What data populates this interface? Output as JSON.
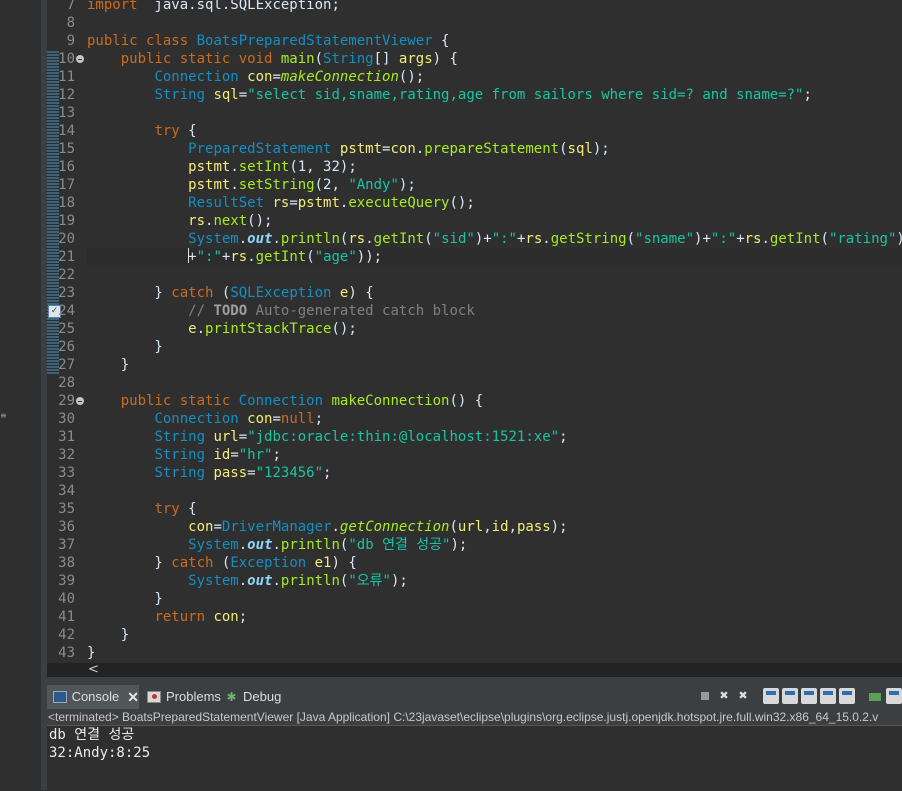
{
  "editor": {
    "lines": [
      {
        "n": "7",
        "t": [
          [
            "kw",
            "import"
          ],
          [
            "",
            "  java.sql.SQLException;"
          ]
        ]
      },
      {
        "n": "8",
        "t": []
      },
      {
        "n": "9",
        "t": [
          [
            "kw",
            "public class"
          ],
          [
            "",
            " "
          ],
          [
            "ty",
            "BoatsPreparedStatementViewer"
          ],
          [
            "",
            " {"
          ]
        ]
      },
      {
        "n": "10",
        "fold": true,
        "qd": true,
        "t": [
          [
            "",
            "    "
          ],
          [
            "kw",
            "public static void"
          ],
          [
            "",
            " "
          ],
          [
            "mt",
            "main"
          ],
          [
            "",
            "("
          ],
          [
            "ty",
            "String"
          ],
          [
            "",
            "[] "
          ],
          [
            "va",
            "args"
          ],
          [
            "",
            ") {"
          ]
        ]
      },
      {
        "n": "11",
        "qd": true,
        "t": [
          [
            "",
            "        "
          ],
          [
            "ty",
            "Connection"
          ],
          [
            "",
            " "
          ],
          [
            "va",
            "con"
          ],
          [
            "",
            "="
          ],
          [
            "sm",
            "makeConnection"
          ],
          [
            "",
            "();"
          ]
        ]
      },
      {
        "n": "12",
        "qd": true,
        "t": [
          [
            "",
            "        "
          ],
          [
            "ty",
            "String"
          ],
          [
            "",
            " "
          ],
          [
            "va",
            "sql"
          ],
          [
            "",
            "="
          ],
          [
            "st",
            "\"select sid,sname,rating,age from sailors where sid=? and sname=?\""
          ],
          [
            "",
            ";"
          ]
        ]
      },
      {
        "n": "13",
        "qd": true,
        "t": []
      },
      {
        "n": "14",
        "qd": true,
        "t": [
          [
            "",
            "        "
          ],
          [
            "kw",
            "try"
          ],
          [
            "",
            " {"
          ]
        ]
      },
      {
        "n": "15",
        "qd": true,
        "t": [
          [
            "",
            "            "
          ],
          [
            "ty",
            "PreparedStatement"
          ],
          [
            "",
            " "
          ],
          [
            "va",
            "pstmt"
          ],
          [
            "",
            "="
          ],
          [
            "va",
            "con"
          ],
          [
            "",
            "."
          ],
          [
            "mt",
            "prepareStatement"
          ],
          [
            "",
            "("
          ],
          [
            "va",
            "sql"
          ],
          [
            "",
            ");"
          ]
        ]
      },
      {
        "n": "16",
        "qd": true,
        "t": [
          [
            "",
            "            "
          ],
          [
            "va",
            "pstmt"
          ],
          [
            "",
            "."
          ],
          [
            "mt",
            "setInt"
          ],
          [
            "",
            "(1, 32);"
          ]
        ]
      },
      {
        "n": "17",
        "qd": true,
        "t": [
          [
            "",
            "            "
          ],
          [
            "va",
            "pstmt"
          ],
          [
            "",
            "."
          ],
          [
            "mt",
            "setString"
          ],
          [
            "",
            "(2, "
          ],
          [
            "st",
            "\"Andy\""
          ],
          [
            "",
            ");"
          ]
        ]
      },
      {
        "n": "18",
        "qd": true,
        "t": [
          [
            "",
            "            "
          ],
          [
            "ty",
            "ResultSet"
          ],
          [
            "",
            " "
          ],
          [
            "va",
            "rs"
          ],
          [
            "",
            "="
          ],
          [
            "va",
            "pstmt"
          ],
          [
            "",
            "."
          ],
          [
            "mt",
            "executeQuery"
          ],
          [
            "",
            "();"
          ]
        ]
      },
      {
        "n": "19",
        "qd": true,
        "t": [
          [
            "",
            "            "
          ],
          [
            "va",
            "rs"
          ],
          [
            "",
            "."
          ],
          [
            "mt",
            "next"
          ],
          [
            "",
            "();"
          ]
        ]
      },
      {
        "n": "20",
        "qd": true,
        "t": [
          [
            "",
            "            "
          ],
          [
            "ty",
            "System"
          ],
          [
            "",
            "."
          ],
          [
            "fi",
            "out"
          ],
          [
            "",
            "."
          ],
          [
            "mt",
            "println"
          ],
          [
            "",
            "("
          ],
          [
            "va",
            "rs"
          ],
          [
            "",
            "."
          ],
          [
            "mt",
            "getInt"
          ],
          [
            "",
            "("
          ],
          [
            "st",
            "\"sid\""
          ],
          [
            "",
            ")+"
          ],
          [
            "st",
            "\":\""
          ],
          [
            "",
            "+"
          ],
          [
            "va",
            "rs"
          ],
          [
            "",
            "."
          ],
          [
            "mt",
            "getString"
          ],
          [
            "",
            "("
          ],
          [
            "st",
            "\"sname\""
          ],
          [
            "",
            ")+"
          ],
          [
            "st",
            "\":\""
          ],
          [
            "",
            "+"
          ],
          [
            "va",
            "rs"
          ],
          [
            "",
            "."
          ],
          [
            "mt",
            "getInt"
          ],
          [
            "",
            "("
          ],
          [
            "st",
            "\"rating\""
          ],
          [
            "",
            ")"
          ]
        ]
      },
      {
        "n": "21",
        "qd": true,
        "current": true,
        "t": [
          [
            "",
            "            "
          ],
          [
            "caret",
            ""
          ],
          [
            "",
            "+"
          ],
          [
            "st",
            "\":\""
          ],
          [
            "",
            "+"
          ],
          [
            "va",
            "rs"
          ],
          [
            "",
            "."
          ],
          [
            "mt",
            "getInt"
          ],
          [
            "",
            "("
          ],
          [
            "st",
            "\"age\""
          ],
          [
            "",
            "));"
          ]
        ]
      },
      {
        "n": "22",
        "qd": true,
        "t": []
      },
      {
        "n": "23",
        "qd": true,
        "t": [
          [
            "",
            "        } "
          ],
          [
            "kw",
            "catch"
          ],
          [
            "",
            " ("
          ],
          [
            "ty",
            "SQLException"
          ],
          [
            "",
            " "
          ],
          [
            "va",
            "e"
          ],
          [
            "",
            ") {"
          ]
        ]
      },
      {
        "n": "24",
        "qd": true,
        "task": true,
        "t": [
          [
            "",
            "            "
          ],
          [
            "cm",
            "// "
          ],
          [
            "td",
            "TODO"
          ],
          [
            "cm",
            " Auto-generated catch block"
          ]
        ]
      },
      {
        "n": "25",
        "qd": true,
        "t": [
          [
            "",
            "            "
          ],
          [
            "va",
            "e"
          ],
          [
            "",
            "."
          ],
          [
            "mt",
            "printStackTrace"
          ],
          [
            "",
            "();"
          ]
        ]
      },
      {
        "n": "26",
        "qd": true,
        "t": [
          [
            "",
            "        }"
          ]
        ]
      },
      {
        "n": "27",
        "qd": true,
        "t": [
          [
            "",
            "    }"
          ]
        ]
      },
      {
        "n": "28",
        "t": []
      },
      {
        "n": "29",
        "fold": true,
        "t": [
          [
            "",
            "    "
          ],
          [
            "kw",
            "public static"
          ],
          [
            "",
            " "
          ],
          [
            "ty",
            "Connection"
          ],
          [
            "",
            " "
          ],
          [
            "mt",
            "makeConnection"
          ],
          [
            "",
            "() {"
          ]
        ]
      },
      {
        "n": "30",
        "t": [
          [
            "",
            "        "
          ],
          [
            "ty",
            "Connection"
          ],
          [
            "",
            " "
          ],
          [
            "va",
            "con"
          ],
          [
            "",
            "="
          ],
          [
            "kw",
            "null"
          ],
          [
            "",
            ";"
          ]
        ]
      },
      {
        "n": "31",
        "t": [
          [
            "",
            "        "
          ],
          [
            "ty",
            "String"
          ],
          [
            "",
            " "
          ],
          [
            "va",
            "url"
          ],
          [
            "",
            "="
          ],
          [
            "st",
            "\"jdbc:oracle:thin:@localhost:1521:xe\""
          ],
          [
            "",
            ";"
          ]
        ]
      },
      {
        "n": "32",
        "t": [
          [
            "",
            "        "
          ],
          [
            "ty",
            "String"
          ],
          [
            "",
            " "
          ],
          [
            "va",
            "id"
          ],
          [
            "",
            "="
          ],
          [
            "st",
            "\"hr\""
          ],
          [
            "",
            ";"
          ]
        ]
      },
      {
        "n": "33",
        "t": [
          [
            "",
            "        "
          ],
          [
            "ty",
            "String"
          ],
          [
            "",
            " "
          ],
          [
            "va",
            "pass"
          ],
          [
            "",
            "="
          ],
          [
            "st",
            "\"123456\""
          ],
          [
            "",
            ";"
          ]
        ]
      },
      {
        "n": "34",
        "t": []
      },
      {
        "n": "35",
        "t": [
          [
            "",
            "        "
          ],
          [
            "kw",
            "try"
          ],
          [
            "",
            " {"
          ]
        ]
      },
      {
        "n": "36",
        "t": [
          [
            "",
            "            "
          ],
          [
            "va",
            "con"
          ],
          [
            "",
            "="
          ],
          [
            "ty",
            "DriverManager"
          ],
          [
            "",
            "."
          ],
          [
            "sm",
            "getConnection"
          ],
          [
            "",
            "("
          ],
          [
            "va",
            "url"
          ],
          [
            "",
            ","
          ],
          [
            "va",
            "id"
          ],
          [
            "",
            ","
          ],
          [
            "va",
            "pass"
          ],
          [
            "",
            ");"
          ]
        ]
      },
      {
        "n": "37",
        "t": [
          [
            "",
            "            "
          ],
          [
            "ty",
            "System"
          ],
          [
            "",
            "."
          ],
          [
            "fi",
            "out"
          ],
          [
            "",
            "."
          ],
          [
            "mt",
            "println"
          ],
          [
            "",
            "("
          ],
          [
            "st",
            "\"db 연결 성공\""
          ],
          [
            "",
            ");"
          ]
        ]
      },
      {
        "n": "38",
        "t": [
          [
            "",
            "        } "
          ],
          [
            "kw",
            "catch"
          ],
          [
            "",
            " ("
          ],
          [
            "ty",
            "Exception"
          ],
          [
            "",
            " "
          ],
          [
            "va",
            "e1"
          ],
          [
            "",
            ") {"
          ]
        ]
      },
      {
        "n": "39",
        "t": [
          [
            "",
            "            "
          ],
          [
            "ty",
            "System"
          ],
          [
            "",
            "."
          ],
          [
            "fi",
            "out"
          ],
          [
            "",
            "."
          ],
          [
            "mt",
            "println"
          ],
          [
            "",
            "("
          ],
          [
            "st",
            "\"오류\""
          ],
          [
            "",
            ");"
          ]
        ]
      },
      {
        "n": "40",
        "t": [
          [
            "",
            "        }"
          ]
        ]
      },
      {
        "n": "41",
        "t": [
          [
            "",
            "        "
          ],
          [
            "kw",
            "return"
          ],
          [
            "",
            " "
          ],
          [
            "va",
            "con"
          ],
          [
            "",
            ";"
          ]
        ]
      },
      {
        "n": "42",
        "t": [
          [
            "",
            "    }"
          ]
        ]
      },
      {
        "n": "43",
        "t": [
          [
            "",
            "}"
          ]
        ]
      }
    ]
  },
  "hscroll": {
    "arrow_label": "<"
  },
  "console_view": {
    "tabs": [
      {
        "label": "Console",
        "icon": "console-icon",
        "active": true
      },
      {
        "label": "Problems",
        "icon": "problems-icon"
      },
      {
        "label": "Debug",
        "icon": "debug-icon"
      }
    ],
    "close_glyph": "✕",
    "status": "<terminated> BoatsPreparedStatementViewer [Java Application] C:\\23javaset\\eclipse\\plugins\\org.eclipse.justj.openjdk.hotspot.jre.full.win32.x86_64_15.0.2.v",
    "output_lines": [
      "db 연결 성공",
      "32:Andy:8:25"
    ]
  },
  "colors": {
    "background": "#2f2f2f",
    "keyword": "#cc6c1d",
    "type": "#1290c3",
    "method": "#a7ec21",
    "string": "#17c6a3",
    "variable": "#f3ec79",
    "field": "#8dd9fc",
    "comment": "#808080"
  }
}
